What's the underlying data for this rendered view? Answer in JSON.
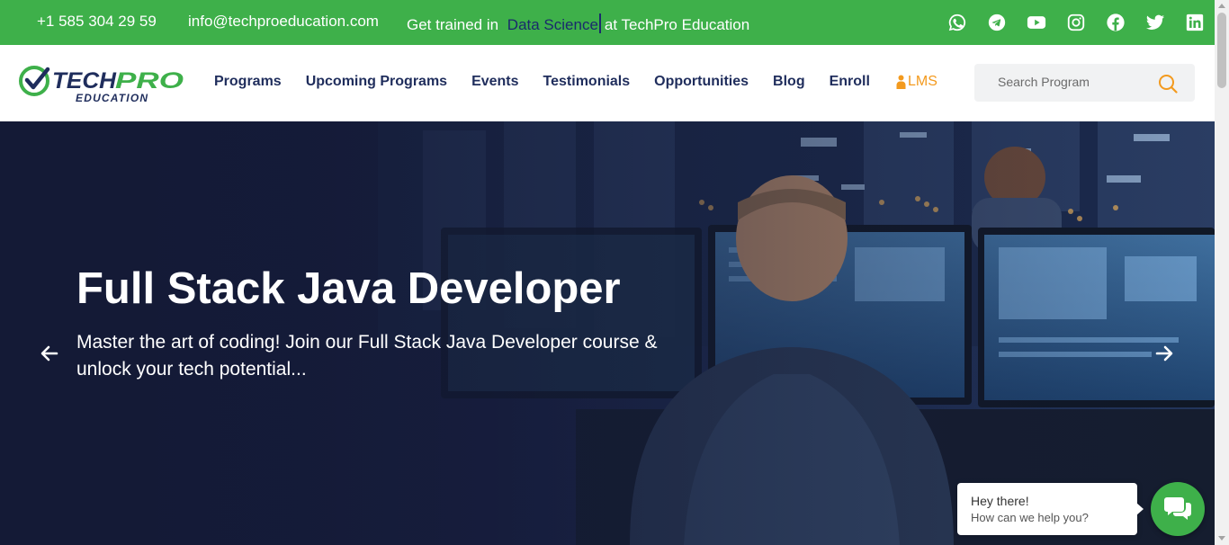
{
  "topbar": {
    "phone": "+1 585 304 29 59",
    "email": "info@techproeducation.com",
    "trained_prefix": "Get trained in",
    "trained_topic": "Data Science",
    "trained_suffix": "at TechPro Education",
    "social_icons": [
      "whatsapp-icon",
      "telegram-icon",
      "youtube-icon",
      "instagram-icon",
      "facebook-icon",
      "twitter-icon",
      "linkedin-icon"
    ],
    "colors": {
      "bar": "#3eb04a",
      "highlight": "#1a2a6c"
    }
  },
  "header": {
    "logo": {
      "text_main": "TECHPRO",
      "text_sub": "EDUCATION"
    },
    "nav": [
      {
        "label": "Programs"
      },
      {
        "label": "Upcoming Programs"
      },
      {
        "label": "Events"
      },
      {
        "label": "Testimonials"
      },
      {
        "label": "Opportunities"
      },
      {
        "label": "Blog"
      },
      {
        "label": "Enroll"
      }
    ],
    "lms_label": "LMS",
    "search": {
      "placeholder": "Search Program"
    },
    "colors": {
      "nav": "#1f2d5c",
      "lms": "#f39a1e",
      "brand_green": "#3eb04a"
    }
  },
  "hero": {
    "title": "Full Stack Java Developer",
    "subtitle": "Master the art of coding! Join our Full Stack Java Developer course & unlock your tech potential...",
    "prev_icon": "arrow-left-icon",
    "next_icon": "arrow-right-icon"
  },
  "chat": {
    "greeting": "Hey there!",
    "prompt": "How can we help you?",
    "icon": "chat-icon"
  }
}
